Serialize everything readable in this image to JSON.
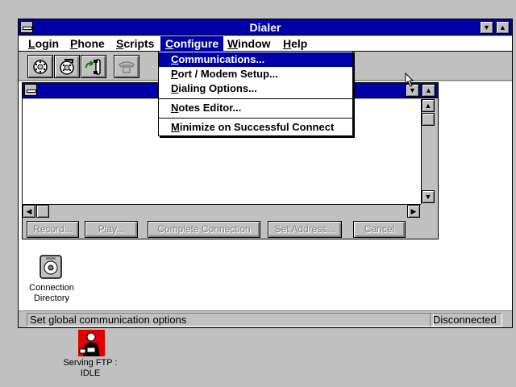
{
  "window": {
    "title": "Dialer"
  },
  "menu": {
    "items": [
      {
        "mnemonic": "L",
        "rest": "ogin"
      },
      {
        "mnemonic": "P",
        "rest": "hone"
      },
      {
        "mnemonic": "S",
        "rest": "cripts"
      },
      {
        "mnemonic": "C",
        "rest": "onfigure"
      },
      {
        "mnemonic": "W",
        "rest": "indow"
      },
      {
        "mnemonic": "H",
        "rest": "elp"
      }
    ]
  },
  "toolbar": {
    "buttons": [
      "directory-icon",
      "quick-dial-icon",
      "dial-icon",
      "hang-up-icon"
    ]
  },
  "configure_menu": {
    "items": [
      {
        "mnemonic": "C",
        "rest": "ommunications..."
      },
      {
        "mnemonic": "P",
        "rest": "ort / Modem Setup..."
      },
      {
        "mnemonic": "D",
        "rest": "ialing Options..."
      },
      {
        "mnemonic": "N",
        "rest": "otes Editor..."
      },
      {
        "mnemonic": "M",
        "rest": "inimize on Successful Connect"
      }
    ]
  },
  "child_window": {
    "buttons": [
      "Record...",
      "Play...",
      "Complete Connection",
      "Set Address...",
      "Cancel"
    ]
  },
  "workspace_icon": {
    "line1": "Connection",
    "line2": "Directory"
  },
  "status": {
    "message": "Set global communication options",
    "connection": "Disconnected"
  },
  "desktop_icon": {
    "line1": "Serving FTP :",
    "line2": "IDLE"
  }
}
